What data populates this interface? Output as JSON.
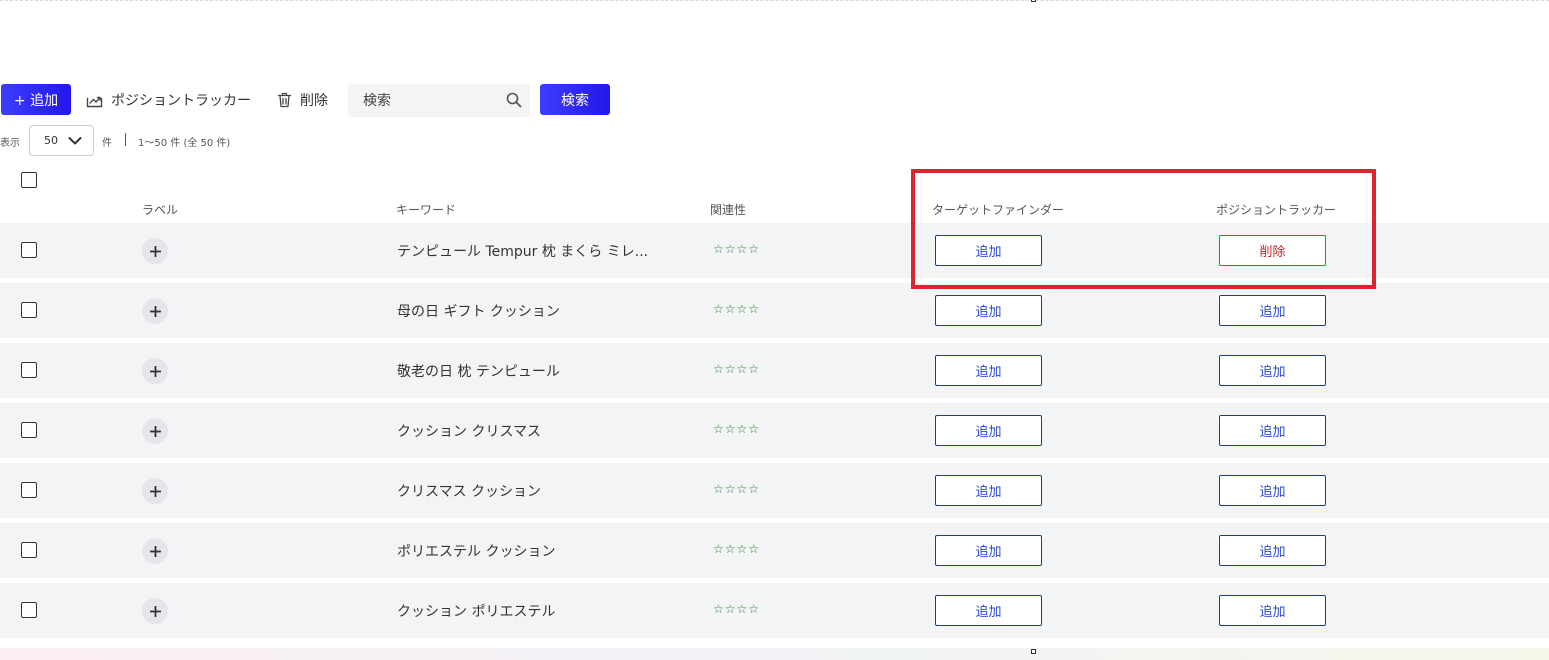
{
  "toolbar": {
    "add_label": "+ 追加",
    "position_tracker_label": "ポジショントラッカー",
    "delete_label": "削除",
    "search_placeholder": "検索",
    "search_button_label": "検索"
  },
  "pagination": {
    "display_label": "表示",
    "per_page": "50",
    "unit_label": "件",
    "count_text": "1～50 件 (全 50 件)"
  },
  "table": {
    "columns": {
      "label": "ラベル",
      "keyword": "キーワード",
      "relevance": "関連性",
      "target_finder": "ターゲットファインダー",
      "position_tracker": "ポジショントラッカー"
    },
    "rows": [
      {
        "keyword": "テンピュール Tempur 枕 まくら ミレ...",
        "relevance": "☆☆☆☆",
        "target_finder": "追加",
        "position_tracker": "削除"
      },
      {
        "keyword": "母の日 ギフト クッション",
        "relevance": "☆☆☆☆",
        "target_finder": "追加",
        "position_tracker": "追加"
      },
      {
        "keyword": "敬老の日 枕 テンピュール",
        "relevance": "☆☆☆☆",
        "target_finder": "追加",
        "position_tracker": "追加"
      },
      {
        "keyword": "クッション クリスマス",
        "relevance": "☆☆☆☆",
        "target_finder": "追加",
        "position_tracker": "追加"
      },
      {
        "keyword": "クリスマス クッション",
        "relevance": "☆☆☆☆",
        "target_finder": "追加",
        "position_tracker": "追加"
      },
      {
        "keyword": "ポリエステル クッション",
        "relevance": "☆☆☆☆",
        "target_finder": "追加",
        "position_tracker": "追加"
      },
      {
        "keyword": "クッション ポリエステル",
        "relevance": "☆☆☆☆",
        "target_finder": "追加",
        "position_tracker": "追加"
      }
    ]
  },
  "icons": {
    "add": "plus-icon",
    "position_tracker": "chart-arrow-icon",
    "delete": "trash-icon",
    "search": "search-icon",
    "select": "chevron-down-icon"
  },
  "colors": {
    "primary": "#2f2bf5",
    "danger": "#c62828",
    "highlight": "#e0242f",
    "link": "#2a4ad0"
  }
}
